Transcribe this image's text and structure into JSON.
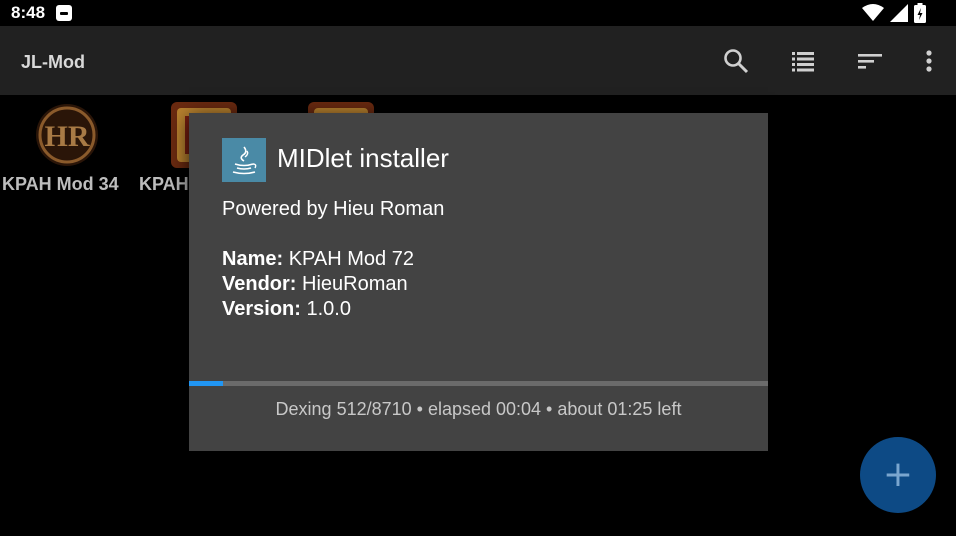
{
  "status_bar": {
    "time": "8:48"
  },
  "app_bar": {
    "title": "JL-Mod",
    "icons": [
      "search-icon",
      "list-view-icon",
      "sort-icon",
      "more-vert-icon"
    ]
  },
  "grid": {
    "items": [
      {
        "label": "KPAH Mod 34"
      },
      {
        "label": "KPAH"
      },
      {
        "label": ""
      }
    ]
  },
  "dialog": {
    "title": "MIDlet installer",
    "powered_by": "Powered by Hieu Roman",
    "name_label": "Name:",
    "name_value": " KPAH Mod 72",
    "vendor_label": "Vendor:",
    "vendor_value": " HieuRoman",
    "version_label": "Version:",
    "version_value": " 1.0.0",
    "progress": 0.059,
    "status": "Dexing 512/8710 • elapsed 00:04 • about 01:25 left"
  },
  "fab": {
    "label": "+"
  },
  "colors": {
    "accent": "#2196f3",
    "fab": "#0d4a85",
    "dialog_bg": "#434343",
    "appbar_bg": "#212121"
  }
}
